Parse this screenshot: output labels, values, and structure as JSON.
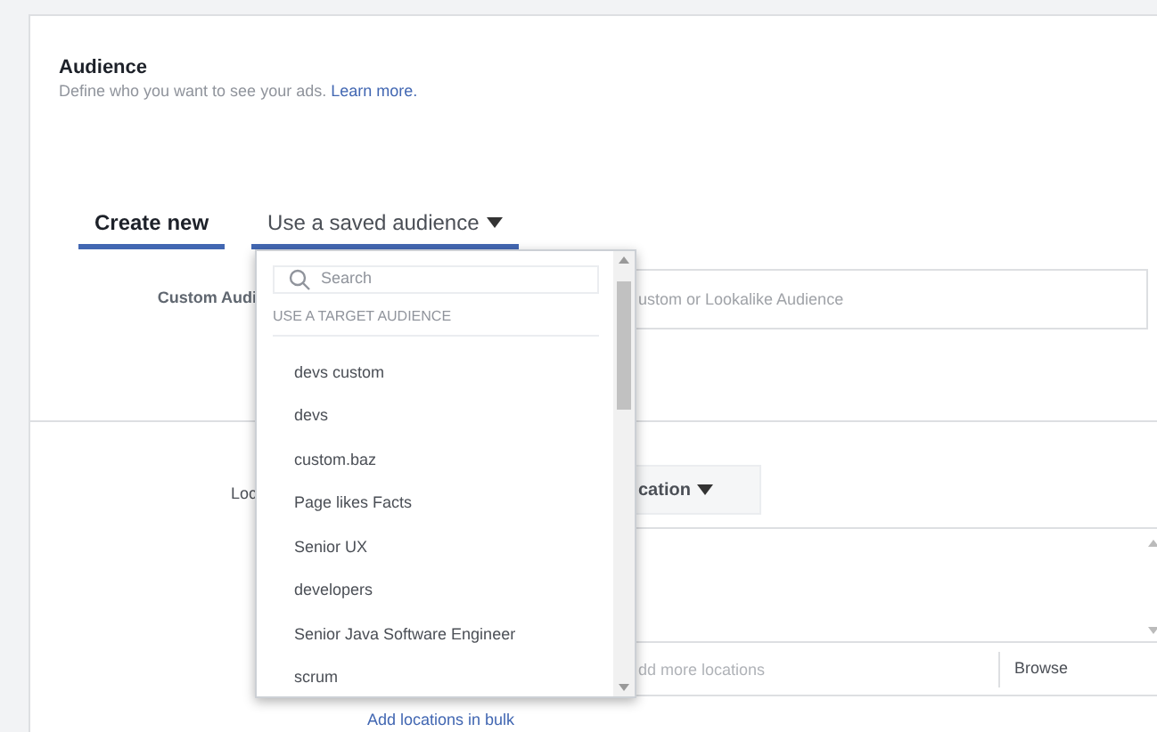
{
  "section": {
    "title": "Audience",
    "description": "Define who you want to see your ads.",
    "learn_more": "Learn more."
  },
  "tabs": [
    {
      "label": "Create new",
      "selected": true,
      "kind": "plain"
    },
    {
      "label": "Use a saved audience",
      "selected": false,
      "open": true,
      "kind": "menu"
    }
  ],
  "custom_audiences": {
    "label": "Custom Audi",
    "placeholder": "ustom or Lookalike Audience"
  },
  "locations": {
    "label": "Loc",
    "button": "cation",
    "input_placeholder": "dd more locations",
    "browse": "Browse",
    "bulk_link": "Add locations in bulk"
  },
  "dropdown": {
    "search_placeholder": "Search",
    "header": "USE A TARGET AUDIENCE",
    "items": [
      "devs custom",
      "devs",
      "custom.baz",
      "Page likes Facts",
      "Senior UX",
      "developers",
      "Senior Java Software Engineer",
      "scrum"
    ]
  }
}
